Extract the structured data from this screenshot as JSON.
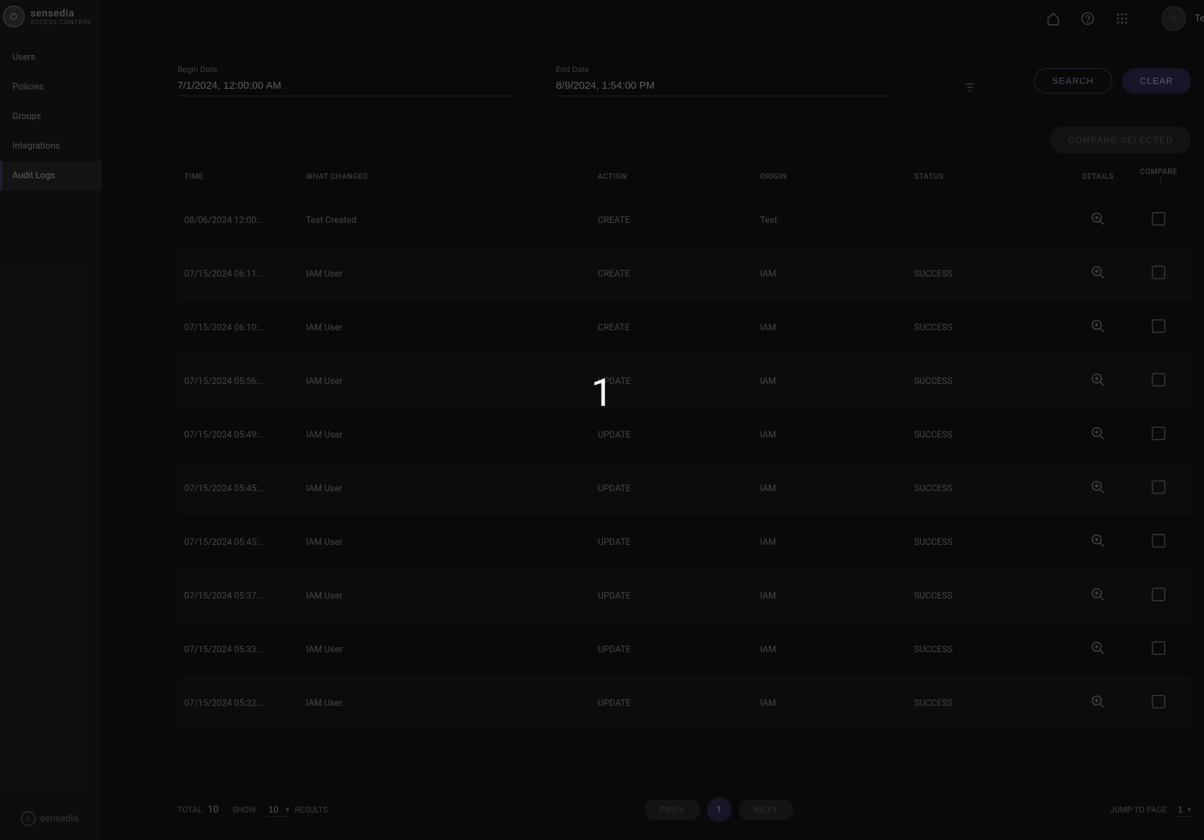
{
  "brand": {
    "name": "sensedia",
    "sub": "ACCESS CONTROL",
    "footer": "sensedia."
  },
  "user": {
    "name": "Tech Writer"
  },
  "overlay_number": "1",
  "sidebar": {
    "items": [
      {
        "label": "Users"
      },
      {
        "label": "Policies"
      },
      {
        "label": "Groups"
      },
      {
        "label": "Integrations"
      },
      {
        "label": "Audit Logs"
      }
    ],
    "active_index": 4
  },
  "filters": {
    "begin_label": "Begin Date",
    "begin_value": "7/1/2024, 12:00:00 AM",
    "end_label": "End Date",
    "end_value": "8/9/2024, 1:54:00 PM",
    "search_label": "SEARCH",
    "clear_label": "CLEAR"
  },
  "compare_selected_label": "COMPARE SELECTED",
  "table": {
    "headers": {
      "time": "TIME",
      "what": "WHAT CHANGED",
      "action": "ACTION",
      "origin": "ORIGIN",
      "status": "STATUS",
      "details": "DETAILS",
      "compare": "COMPARE"
    },
    "rows": [
      {
        "time": "08/06/2024 12:00:...",
        "what": "Test Created",
        "action": "CREATE",
        "origin": "Test",
        "status": ""
      },
      {
        "time": "07/15/2024 06:11:...",
        "what": "IAM User",
        "action": "CREATE",
        "origin": "IAM",
        "status": "SUCCESS"
      },
      {
        "time": "07/15/2024 06:10:...",
        "what": "IAM User",
        "action": "CREATE",
        "origin": "IAM",
        "status": "SUCCESS"
      },
      {
        "time": "07/15/2024 05:56:...",
        "what": "IAM User",
        "action": "UPDATE",
        "origin": "IAM",
        "status": "SUCCESS"
      },
      {
        "time": "07/15/2024 05:49:...",
        "what": "IAM User",
        "action": "UPDATE",
        "origin": "IAM",
        "status": "SUCCESS"
      },
      {
        "time": "07/15/2024 05:45:...",
        "what": "IAM User",
        "action": "UPDATE",
        "origin": "IAM",
        "status": "SUCCESS"
      },
      {
        "time": "07/15/2024 05:45:...",
        "what": "IAM User",
        "action": "UPDATE",
        "origin": "IAM",
        "status": "SUCCESS"
      },
      {
        "time": "07/15/2024 05:37:...",
        "what": "IAM User",
        "action": "UPDATE",
        "origin": "IAM",
        "status": "SUCCESS"
      },
      {
        "time": "07/15/2024 05:33:...",
        "what": "IAM User",
        "action": "UPDATE",
        "origin": "IAM",
        "status": "SUCCESS"
      },
      {
        "time": "07/15/2024 05:32:...",
        "what": "IAM User",
        "action": "UPDATE",
        "origin": "IAM",
        "status": "SUCCESS"
      }
    ]
  },
  "pager": {
    "total_label": "TOTAL",
    "total_value": "10",
    "show_label": "SHOW",
    "show_value": "10",
    "results_label": "RESULTS",
    "prev_label": "PREV",
    "page_num": "1",
    "next_label": "NEXT",
    "jump_label": "JUMP TO PAGE",
    "jump_value": "1"
  }
}
